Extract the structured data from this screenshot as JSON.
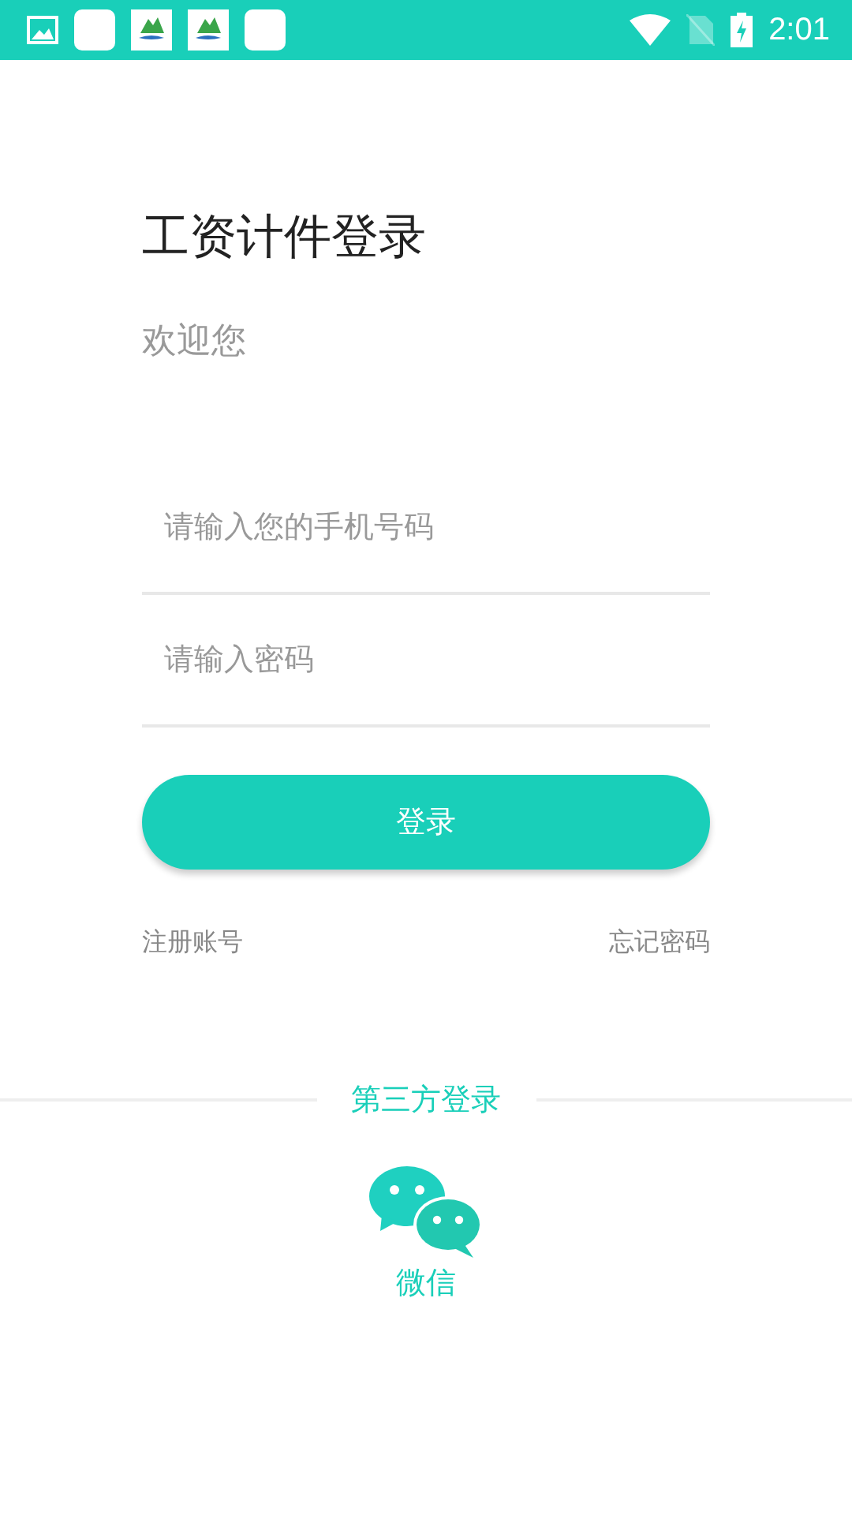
{
  "status_bar": {
    "time": "2:01"
  },
  "title": "工资计件登录",
  "subtitle": "欢迎您",
  "fields": [
    {
      "placeholder": "请输入您的手机号码"
    },
    {
      "placeholder": "请输入密码"
    }
  ],
  "login_button": "登录",
  "links": [
    "注册账号",
    "忘记密码"
  ],
  "third_party": {
    "heading": "第三方登录",
    "wechat_label": "微信"
  }
}
